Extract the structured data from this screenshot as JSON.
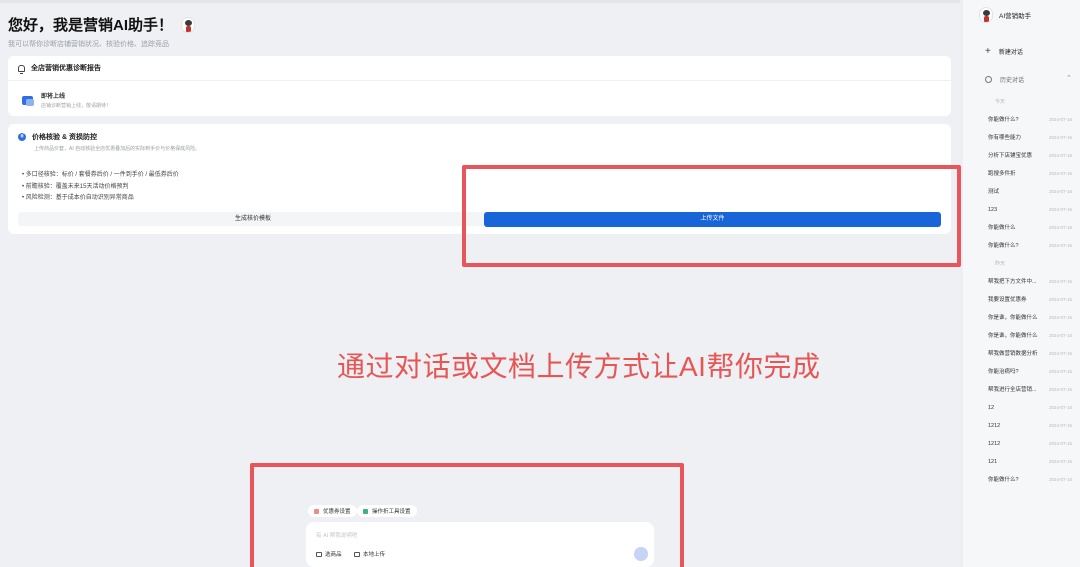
{
  "greeting": {
    "title": "您好，我是营销AI助手！",
    "subtitle": "我可以帮你诊断店铺营销状况、核验价格、追踪竞品"
  },
  "diagnosis_card": {
    "title": "全店营销优惠诊断报告",
    "item_title": "即将上线",
    "item_subtitle": "店铺诊断营销上线，敬请期待！"
  },
  "price_card": {
    "title": "价格核验 & 资损防控",
    "description": "上传商品价套，AI 自动核验全店优惠叠加后的实际到手价与价格保底风险。",
    "bullets": [
      "• 多口径核验：标价 / 套餐券后价 / 一件到手价 / 最低券后价",
      "• 前瞻核验：覆盖未来15天活动价格预判",
      "• 风险检测：基于成本价自动识别异常商品"
    ],
    "generate_button": "生成核价模板",
    "upload_button": "上传文件"
  },
  "caption": "通过对话或文档上传方式让AI帮你完成",
  "composer": {
    "chips": [
      {
        "label": "优惠券设置",
        "color": "#f08a8a"
      },
      {
        "label": "操作折工具设置",
        "color": "#3fb27f"
      }
    ],
    "placeholder": "有 AI 帮我说明吧",
    "tools": [
      "选商品",
      "本地上传"
    ]
  },
  "sidebar": {
    "title": "AI营销助手",
    "new_chat": "新建对话",
    "history": "历史对话",
    "groups": [
      {
        "label": "今天",
        "items": [
          {
            "title": "你能做什么?",
            "date": "2024-07-16"
          },
          {
            "title": "你有哪些能力",
            "date": "2024-07-16"
          },
          {
            "title": "分析下店铺宝优惠",
            "date": "2024-07-16"
          },
          {
            "title": "跑搜多件折",
            "date": "2024-07-16"
          },
          {
            "title": "测试",
            "date": "2024-07-16"
          },
          {
            "title": "123",
            "date": "2024-07-16"
          },
          {
            "title": "你能做什么",
            "date": "2024-07-16"
          },
          {
            "title": "你能做什么?",
            "date": "2024-07-16"
          }
        ]
      },
      {
        "label": "昨天",
        "items": [
          {
            "title": "帮我把下方文件中...",
            "date": "2024-07-15"
          },
          {
            "title": "我要设置优惠券",
            "date": "2024-07-15"
          },
          {
            "title": "你是谁，你能做什么",
            "date": "2024-07-15"
          },
          {
            "title": "你是谁，你能做什么",
            "date": "2024-07-15"
          },
          {
            "title": "帮我做营销数据分析",
            "date": "2024-07-15"
          },
          {
            "title": "你能治病吗?",
            "date": "2024-07-15"
          },
          {
            "title": "帮我进行全店营销...",
            "date": "2024-07-15"
          },
          {
            "title": "12",
            "date": "2024-07-15"
          },
          {
            "title": "1212",
            "date": "2024-07-15"
          },
          {
            "title": "1212",
            "date": "2024-07-15"
          },
          {
            "title": "121",
            "date": "2024-07-15"
          },
          {
            "title": "你能做什么?",
            "date": "2024-07-15"
          }
        ]
      }
    ]
  },
  "colors": {
    "accent": "#1765d8",
    "annotation_red": "#e8555a",
    "caption_red": "#e85555"
  }
}
